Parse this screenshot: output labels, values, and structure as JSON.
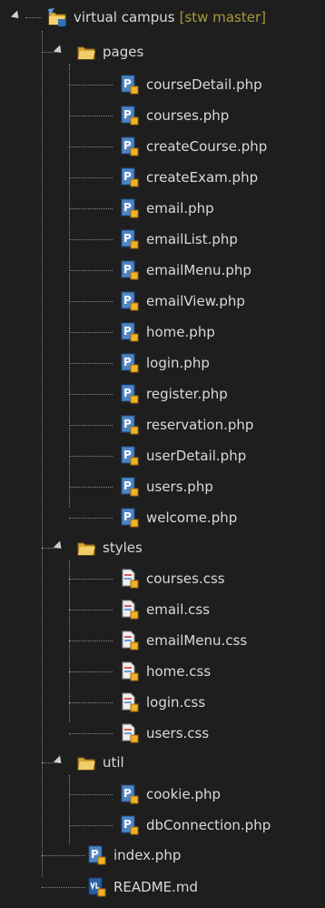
{
  "root": {
    "label": "virtual campus",
    "branch": "[stw master]"
  },
  "folders": {
    "pages": {
      "label": "pages",
      "files": [
        "courseDetail.php",
        "courses.php",
        "createCourse.php",
        "createExam.php",
        "email.php",
        "emailList.php",
        "emailMenu.php",
        "emailView.php",
        "home.php",
        "login.php",
        "register.php",
        "reservation.php",
        "userDetail.php",
        "users.php",
        "welcome.php"
      ]
    },
    "styles": {
      "label": "styles",
      "files": [
        "courses.css",
        "email.css",
        "emailMenu.css",
        "home.css",
        "login.css",
        "users.css"
      ]
    },
    "util": {
      "label": "util",
      "files": [
        "cookie.php",
        "dbConnection.php"
      ]
    }
  },
  "root_files": [
    "index.php",
    "README.md"
  ],
  "colors": {
    "background": "#1e1e1e",
    "text": "#d9d9d9",
    "branch_text": "#a89a3c"
  },
  "icons": {
    "project": "project-folder-icon",
    "folder": "folder-open-icon",
    "php": "php-file-icon",
    "css": "css-file-icon",
    "md": "markdown-file-icon"
  }
}
